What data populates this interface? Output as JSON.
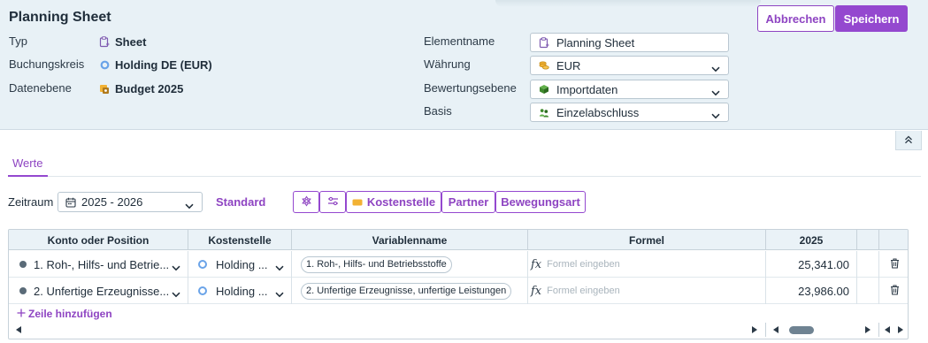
{
  "header": {
    "title": "Planning Sheet",
    "meta": [
      {
        "label": "Typ",
        "value": "Sheet",
        "icon": "sheet-icon"
      },
      {
        "label": "Buchungskreis",
        "value": "Holding DE (EUR)",
        "icon": "ring-icon"
      },
      {
        "label": "Datenebene",
        "value": "Budget 2025",
        "icon": "budget-icon"
      }
    ],
    "fields": [
      {
        "label": "Elementname",
        "value": "Planning Sheet",
        "icon": "sheet-icon"
      },
      {
        "label": "Währung",
        "value": "EUR",
        "icon": "coins-icon"
      },
      {
        "label": "Bewertungsebene",
        "value": "Importdaten",
        "icon": "box-icon"
      },
      {
        "label": "Basis",
        "value": "Einzelabschluss",
        "icon": "people-icon"
      }
    ],
    "cancel_label": "Abbrechen",
    "save_label": "Speichern"
  },
  "tabs": [
    {
      "label": "Werte",
      "active": true
    }
  ],
  "toolbar": {
    "zeitraum_label": "Zeitraum",
    "zeitraum_value": "2025 - 2026",
    "standard_label": "Standard",
    "kostenstelle_label": "Kostenstelle",
    "partner_label": "Partner",
    "bewegungsart_label": "Bewegungsart"
  },
  "table": {
    "columns": [
      "Konto oder Position",
      "Kostenstelle",
      "Variablenname",
      "Formel",
      "2025"
    ],
    "rows": [
      {
        "konto": "1. Roh-, Hilfs- und Betrie...",
        "kostenstelle": "Holding ...",
        "variable": "1. Roh-, Hilfs- und Betriebsstoffe",
        "formel_placeholder": "Formel eingeben",
        "value": "25,341.00"
      },
      {
        "konto": "2. Unfertige Erzeugnisse...",
        "kostenstelle": "Holding ...",
        "variable": "2. Unfertige Erzeugnisse, unfertige Leistungen",
        "formel_placeholder": "Formel eingeben",
        "value": "23,986.00"
      }
    ],
    "add_row_label": "Zeile hinzufügen"
  },
  "colors": {
    "accent": "#9448cf",
    "header_bg": "#e8f1f6",
    "table_header_bg": "#eaf2f7"
  }
}
